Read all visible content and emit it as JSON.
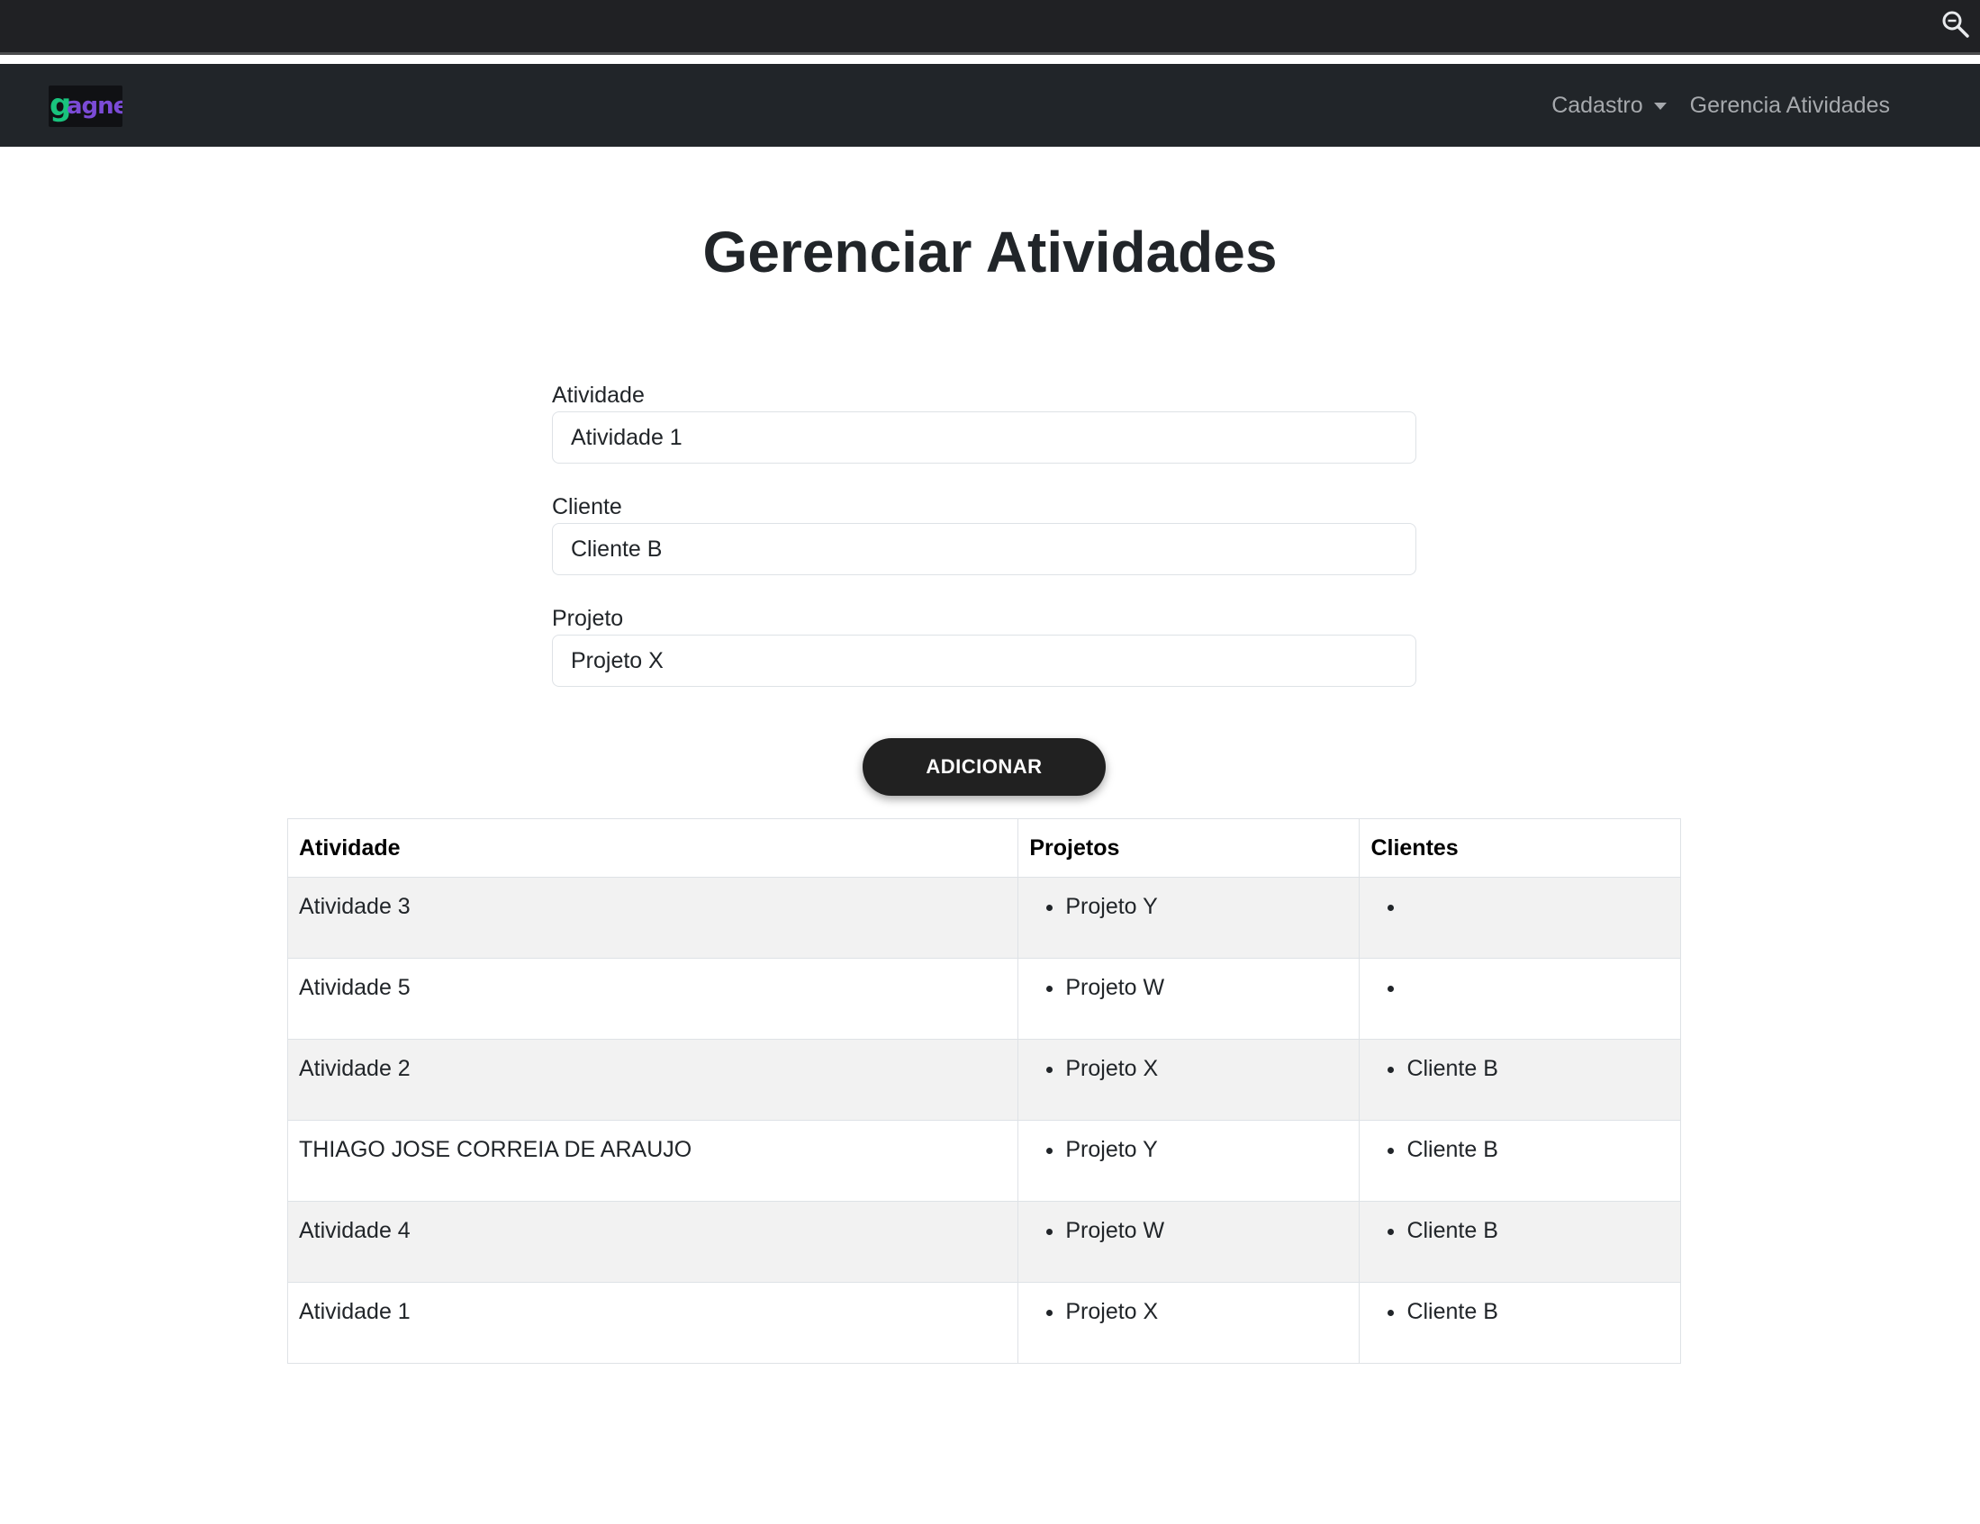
{
  "browser": {
    "zoom_icon": "magnifier-zoom-icon"
  },
  "navbar": {
    "logo_text": "agnes",
    "cadastro_label": "Cadastro",
    "gerencia_label": "Gerencia Atividades"
  },
  "page": {
    "title": "Gerenciar Atividades"
  },
  "form": {
    "atividade": {
      "label": "Atividade",
      "value": "Atividade 1"
    },
    "cliente": {
      "label": "Cliente",
      "value": "Cliente B"
    },
    "projeto": {
      "label": "Projeto",
      "value": "Projeto X"
    },
    "submit_label": "ADICIONAR"
  },
  "table": {
    "headers": [
      "Atividade",
      "Projetos",
      "Clientes"
    ],
    "rows": [
      {
        "atividade": "Atividade 3",
        "projeto": "Projeto Y",
        "cliente": ""
      },
      {
        "atividade": "Atividade 5",
        "projeto": "Projeto W",
        "cliente": ""
      },
      {
        "atividade": "Atividade 2",
        "projeto": "Projeto X",
        "cliente": "Cliente B"
      },
      {
        "atividade": "THIAGO JOSE CORREIA DE ARAUJO",
        "projeto": "Projeto Y",
        "cliente": "Cliente B"
      },
      {
        "atividade": "Atividade 4",
        "projeto": "Projeto W",
        "cliente": "Cliente B"
      },
      {
        "atividade": "Atividade 1",
        "projeto": "Projeto X",
        "cliente": "Cliente B"
      }
    ]
  },
  "colors": {
    "navbar_bg": "#212529",
    "topbar_bg": "#202124",
    "button_bg": "#212121",
    "row_stripe": "#f2f2f2",
    "logo_green": "#19c37d",
    "logo_purple": "#7b4bd6"
  }
}
